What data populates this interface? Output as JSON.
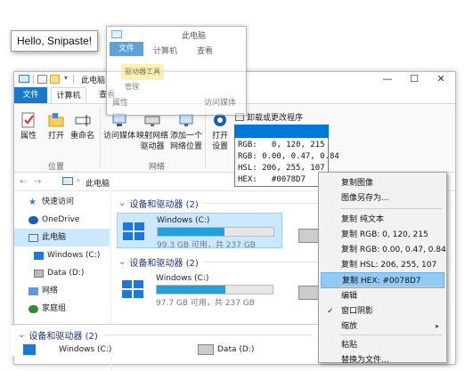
{
  "snip_label": "Hello, Snipaste!",
  "window": {
    "title": "此电脑",
    "controls": {
      "minimize": "—",
      "maximize": "☐",
      "close": "✕"
    },
    "tabs": {
      "file": "文件",
      "computer": "计算机",
      "view": "查看"
    }
  },
  "ribbon": {
    "properties": "属性",
    "open": "打开",
    "rename": "重命名",
    "access_media": "访问媒体",
    "map_drive": "映射网络\n驱动器",
    "add_location": "添加一个\n网络位置",
    "open_settings": "打开\n设置",
    "uninstall": "卸载或更改程序",
    "group_location": "位置",
    "group_network": "网络"
  },
  "address": {
    "path": "此电脑",
    "sep": "›",
    "back": "←",
    "forward": "→"
  },
  "nav": {
    "quick": "快速访问",
    "onedrive": "OneDrive",
    "thispc": "此电脑",
    "windows_c": "Windows (C:)",
    "data_d": "Data (D:)",
    "network": "网络",
    "homegroup": "家庭组"
  },
  "content": {
    "group_title": "设备和驱动器 (2)",
    "drives": [
      {
        "name": "Windows (C:)",
        "size": "99.3 GB 可用，共 237 GB",
        "used": 0.58
      },
      {
        "name": "Windows (C:)",
        "size": "97.7 GB 可用，共 237 GB",
        "used": 0.59
      }
    ],
    "drives_lower": [
      {
        "name": "Windows (C:)"
      },
      {
        "name": "Data (D:)"
      }
    ]
  },
  "ghost": {
    "title": "此电脑",
    "tab_file": "文件",
    "tab_comp": "计算机",
    "tab_view": "查看",
    "item_tools": "驱动器工具",
    "item_manage": "管理",
    "item_props": "属性",
    "item_access": "访问媒体"
  },
  "color_info": {
    "rgb": "RGB:   0, 120, 215",
    "rgb2": "RGB: 0.00, 0.47, 0.84",
    "hsl": "HSL: 206, 255, 107",
    "hex": "HEX:   #0078D7",
    "swatch": "#0078d7"
  },
  "context_menu": {
    "copy_image": "复制图像",
    "save_image": "图像另存为...",
    "copy_text": "复制 纯文本",
    "copy_rgb": "复制 RGB: 0, 120, 215",
    "copy_rgb_f": "复制 RGB: 0.00, 0.47, 0.84",
    "copy_hsl": "复制 HSL: 206, 255, 107",
    "copy_hex": "复制 HEX: #0078D7",
    "edit": "编辑",
    "shadow": "窗口阴影",
    "shadow_check": "✓",
    "zoom": "缩放",
    "zoom_arrow": "▸",
    "paste": "粘贴",
    "replace_file": "替换为文件..."
  }
}
